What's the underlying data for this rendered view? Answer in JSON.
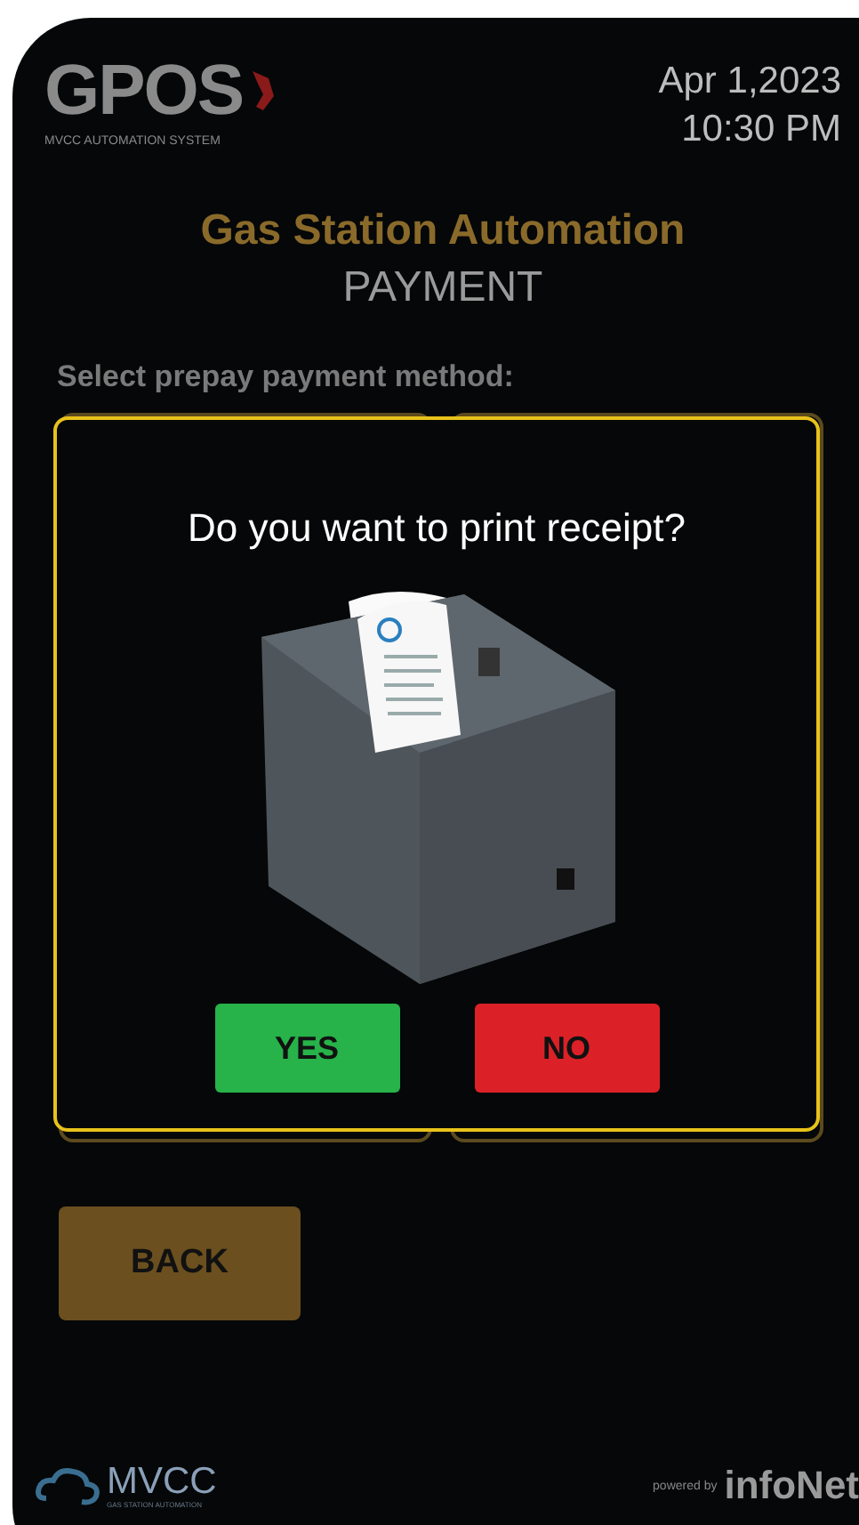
{
  "header": {
    "logo": "GPOS",
    "logo_subtitle": "MVCC AUTOMATION SYSTEM",
    "date": "Apr 1,2023",
    "time": "10:30 PM"
  },
  "title": "Gas Station Automation",
  "subtitle": "PAYMENT",
  "prompt": "Select prepay payment method:",
  "dialog": {
    "question": "Do you want to print receipt?",
    "buttons": [
      {
        "label": "YES",
        "kind": "confirm"
      },
      {
        "label": "NO",
        "kind": "cancel"
      }
    ]
  },
  "back_button": "BACK",
  "footer": {
    "brand": "MVCC",
    "brand_subtitle": "GAS STATION AUTOMATION",
    "powered_by": "powered by",
    "partner": "infoNet"
  }
}
